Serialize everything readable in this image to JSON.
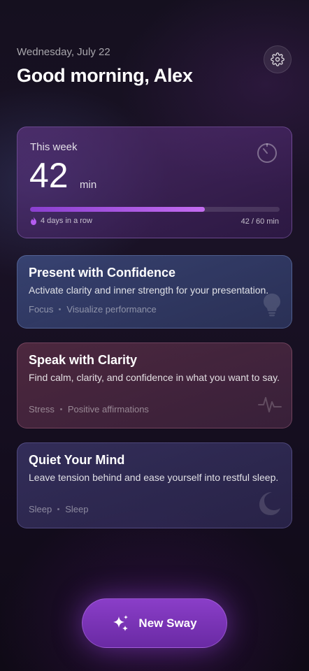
{
  "header": {
    "date": "Wednesday, July 22",
    "greeting": "Good morning, Alex",
    "settings_icon": "gear-icon"
  },
  "week": {
    "label": "This week",
    "minutes": "42",
    "unit": "min",
    "progress_fraction": 0.7,
    "streak": "4 days in a row",
    "progress_text": "42 / 60 min",
    "icon": "timer-icon"
  },
  "sessions": [
    {
      "title": "Present with Confidence",
      "description": "Activate clarity and inner strength for your presentation.",
      "tag1": "Focus",
      "tag2": "Visualize performance",
      "icon": "lightbulb-icon"
    },
    {
      "title": "Speak with Clarity",
      "description": "Find calm, clarity, and confidence in what you want to say.",
      "tag1": "Stress",
      "tag2": "Positive affirmations",
      "icon": "pulse-icon"
    },
    {
      "title": "Quiet Your Mind",
      "description": "Leave tension behind and ease yourself into restful sleep.",
      "tag1": "Sleep",
      "tag2": "Sleep",
      "icon": "moon-icon"
    }
  ],
  "cta": {
    "label": "New Sway",
    "icon": "sparkles-icon"
  },
  "colors": {
    "accent": "#8a3ec8",
    "progress": "#c46cf0"
  }
}
